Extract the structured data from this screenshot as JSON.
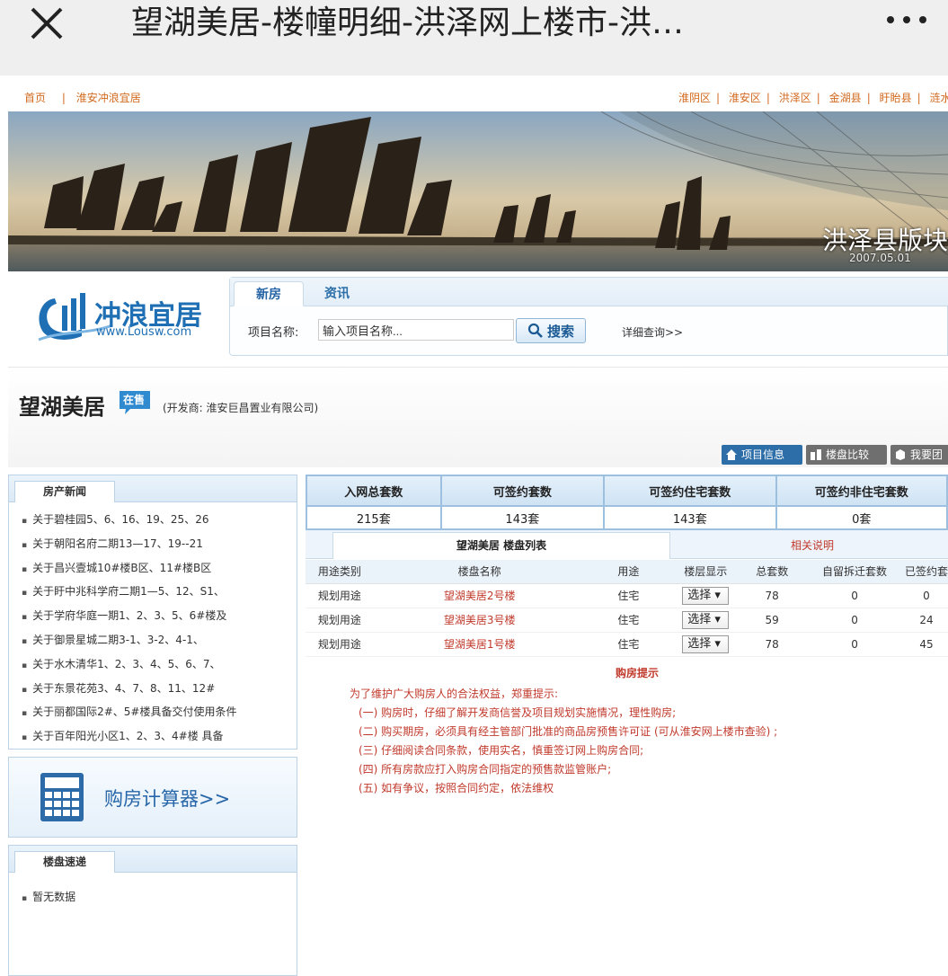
{
  "appbar": {
    "title": "望湖美居-楼幢明细-洪泽网上楼市-洪…"
  },
  "toplinks": {
    "left": [
      "首页",
      "淮安冲浪宜居"
    ],
    "right": [
      "淮阴区",
      "淮安区",
      "洪泽区",
      "金湖县",
      "盱眙县",
      "涟水"
    ]
  },
  "banner": {
    "caption": "洪泽县版块",
    "date": "2007.05.01"
  },
  "logo": {
    "name": "冲浪宜居",
    "url": "www.Lousw.com"
  },
  "search": {
    "tabs": [
      "新房",
      "资讯"
    ],
    "label": "项目名称:",
    "placeholder": "输入项目名称...",
    "button": "搜索",
    "detail": "详细查询>>"
  },
  "project": {
    "name": "望湖美居",
    "status": "在售",
    "developer": "(开发商:  淮安巨昌置业有限公司)",
    "actions": [
      "项目信息",
      "楼盘比较",
      "我要团"
    ]
  },
  "news": {
    "title": "房产新闻",
    "items": [
      "关于碧桂园5、6、16、19、25、26",
      "关于朝阳名府二期13—17、19--21",
      "关于昌兴壹城10#楼B区、11#楼B区",
      "关于盱中兆科学府二期1—5、12、S1、",
      "关于学府华庭一期1、2、3、5、6#楼及",
      "关于御景星城二期3-1、3-2、4-1、",
      "关于水木清华1、2、3、4、5、6、7、",
      "关于东景花苑3、4、7、8、11、12#",
      "关于丽都国际2#、5#楼具备交付使用条件",
      "关于百年阳光小区1、2、3、4#楼 具备"
    ]
  },
  "calculator": {
    "label": "购房计算器>>"
  },
  "quick": {
    "title": "楼盘速递",
    "items": [
      "暂无数据"
    ]
  },
  "stats": {
    "headers": [
      "入网总套数",
      "可签约套数",
      "可签约住宅套数",
      "可签约非住宅套数"
    ],
    "values": [
      "215套",
      "143套",
      "143套",
      "0套"
    ]
  },
  "buildings": {
    "tab_list": "望湖美居 楼盘列表",
    "tab_note": "相关说明",
    "headers": [
      "用途类别",
      "楼盘名称",
      "用途",
      "楼层显示",
      "总套数",
      "自留拆迁套数",
      "已签约套"
    ],
    "rows": [
      {
        "category": "规划用途",
        "name": "望湖美居2号楼",
        "use": "住宅",
        "floor": "选择",
        "total": "78",
        "reserved": "0",
        "signed": "0"
      },
      {
        "category": "规划用途",
        "name": "望湖美居3号楼",
        "use": "住宅",
        "floor": "选择",
        "total": "59",
        "reserved": "0",
        "signed": "24"
      },
      {
        "category": "规划用途",
        "name": "望湖美居1号楼",
        "use": "住宅",
        "floor": "选择",
        "total": "78",
        "reserved": "0",
        "signed": "45"
      }
    ]
  },
  "tips": {
    "title": "购房提示",
    "intro": "为了维护广大购房人的合法权益，郑重提示:",
    "items": [
      "(一) 购房时，仔细了解开发商信誉及项目规划实施情况，理性购房;",
      "(二) 购买期房，必须具有经主管部门批准的商品房预售许可证 (可从淮安网上楼市查验) ;",
      "(三) 仔细阅读合同条款，使用实名，慎重签订网上购房合同;",
      "(四) 所有房款应打入购房合同指定的预售款监管账户;",
      "(五) 如有争议，按照合同约定，依法维权"
    ]
  },
  "colors": {
    "accent": "#2d6ea8",
    "link_orange": "#d2691e",
    "warning_red": "#c0392b"
  }
}
